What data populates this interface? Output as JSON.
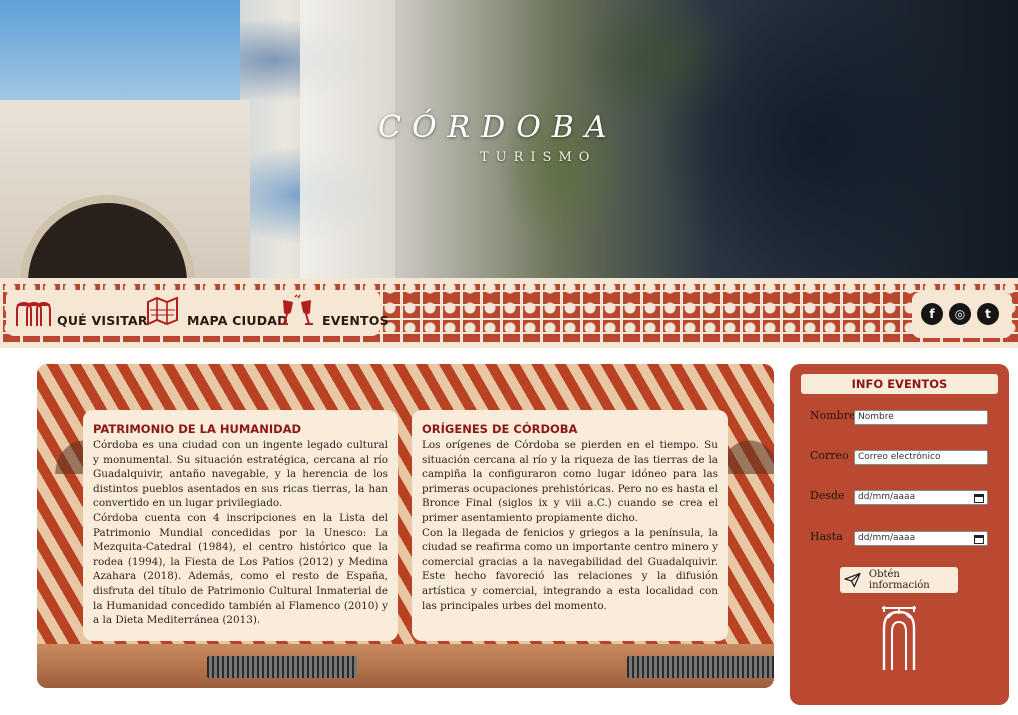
{
  "hero": {
    "title": "CÓRDOBA",
    "subtitle": "TURISMO"
  },
  "nav": {
    "items": [
      {
        "label": "QUÉ VISITAR",
        "icon": "arches-icon"
      },
      {
        "label": "MAPA CIUDAD",
        "icon": "map-icon"
      },
      {
        "label": "EVENTOS",
        "icon": "wine-glasses-icon"
      }
    ],
    "social": [
      {
        "name": "facebook-icon",
        "glyph": "f"
      },
      {
        "name": "instagram-icon",
        "glyph": "◎"
      },
      {
        "name": "twitter-icon",
        "glyph": "t"
      }
    ]
  },
  "sections": [
    {
      "title": "PATRIMONIO DE LA HUMANIDAD",
      "paragraphs": [
        "Córdoba es una ciudad con un ingente legado cultural y monumental. Su situación estratégica, cercana al río Guadalquivir, antaño navegable, y la herencia de los distintos pueblos asentados en sus ricas tierras, la han convertido en un lugar privilegiado.",
        "Córdoba cuenta con 4 inscripciones en la Lista del Patrimonio Mundial concedidas por la Unesco: La Mezquita-Catedral (1984), el centro histórico que la rodea (1994), la Fiesta de Los Patios (2012) y Medina Azahara (2018). Además, como el resto de España, disfruta del título de Patrimonio Cultural Inmaterial de la Humanidad concedido también al Flamenco (2010) y a la Dieta Mediterránea (2013)."
      ]
    },
    {
      "title": "ORÍGENES DE CÓRDOBA",
      "paragraphs": [
        "Los orígenes de Córdoba se pierden en el tiempo. Su situación cercana al río y la riqueza de las tierras de la campiña la configuraron como lugar idóneo para las primeras ocupaciones prehistóricas. Pero no es hasta el Bronce Final (siglos ix y viii a.C.) cuando se crea el primer asentamiento propiamente dicho.",
        "Con la llegada de fenicios y griegos a la península, la ciudad se reafirma como un importante centro minero y comercial gracias a la navegabilidad del Guadalquivir. Este hecho favoreció las relaciones y la difusión artística y comercial, integrando a esta localidad con las principales urbes del momento."
      ]
    }
  ],
  "form": {
    "title": "INFO EVENTOS",
    "fields": [
      {
        "label": "Nombre",
        "placeholder": "Nombre",
        "type": "text"
      },
      {
        "label": "Correo",
        "placeholder": "Correo electrónico",
        "type": "email"
      },
      {
        "label": "Desde",
        "placeholder": "dd/mm/aaaa",
        "type": "date"
      },
      {
        "label": "Hasta",
        "placeholder": "dd/mm/aaaa",
        "type": "date"
      }
    ],
    "button_label": "Obtén información",
    "button_icon": "send-icon",
    "decor_icon": "arch-icon"
  },
  "colors": {
    "brand_red": "#b94a31",
    "title_red": "#8a1616",
    "cream": "#faecdb"
  }
}
